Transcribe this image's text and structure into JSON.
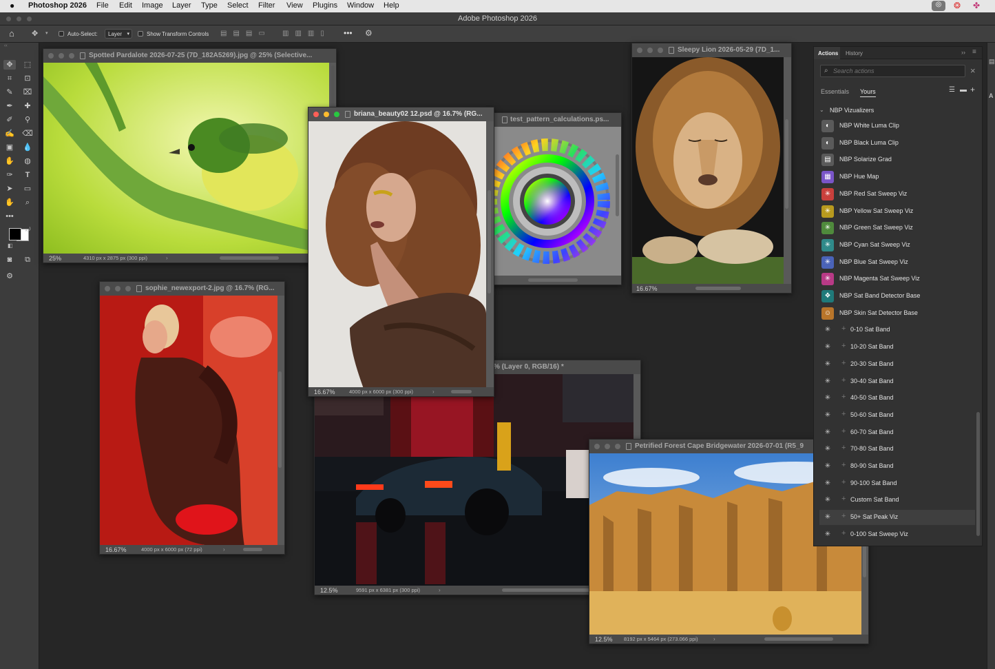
{
  "menubar": {
    "app_name": "Photoshop 2026",
    "items": [
      "File",
      "Edit",
      "Image",
      "Layer",
      "Type",
      "Select",
      "Filter",
      "View",
      "Plugins",
      "Window",
      "Help"
    ]
  },
  "window": {
    "title": "Adobe Photoshop 2026"
  },
  "options": {
    "auto_select_label": "Auto-Select:",
    "layer_dropdown": "Layer",
    "show_transform_label": "Show Transform Controls"
  },
  "documents": {
    "pardalote": {
      "title": "Spotted Pardalote 2026-07-25 (7D_182A5269).jpg @ 25% (Selective...",
      "zoom": "25%",
      "dims": "4310 px x 2875 px (300 ppi)"
    },
    "briana": {
      "title": "briana_beauty02 12.psd @ 16.7% (RG...",
      "zoom": "16.67%",
      "dims": "4000 px x 6000 px (300 ppi)"
    },
    "testpattern": {
      "title": "test_pattern_calculations.ps..."
    },
    "lion": {
      "title": "Sleepy Lion 2026-05-29 (7D_1...",
      "zoom": "16.67%"
    },
    "sophie": {
      "title": "sophie_newexport-2.jpg @ 16.7% (RG...",
      "zoom": "16.67%",
      "dims": "4000 px x 6000 px (72 ppi)"
    },
    "car": {
      "title": "% (Layer 0, RGB/16) *",
      "zoom": "12.5%",
      "dims": "9591 px x 6381 px (300 ppi)"
    },
    "forest": {
      "title": "Petrified Forest Cape Bridgewater 2026-07-01 (R5_9",
      "zoom": "12.5%",
      "dims": "8192 px x 5464 px (273.066 ppi)"
    }
  },
  "panel": {
    "tabs": [
      "Actions",
      "History"
    ],
    "search_placeholder": "Search actions",
    "subtabs": [
      "Essentials",
      "Yours"
    ],
    "group": "NBP Vizualizers",
    "actions": [
      {
        "label": "NBP White Luma Clip",
        "color": "#5a5a5a",
        "glyph": "◐"
      },
      {
        "label": "NBP Black Luma Clip",
        "color": "#5a5a5a",
        "glyph": "◐"
      },
      {
        "label": "NBP Solarize Grad",
        "color": "#5a5a5a",
        "glyph": "▤"
      },
      {
        "label": "NBP Hue Map",
        "color": "#7a55c8",
        "glyph": "▦"
      },
      {
        "label": "NBP Red Sat Sweep Viz",
        "color": "#c9403c",
        "glyph": "✳"
      },
      {
        "label": "NBP Yellow Sat Sweep Viz",
        "color": "#b89a1e",
        "glyph": "✳"
      },
      {
        "label": "NBP Green Sat Sweep Viz",
        "color": "#4f8a3c",
        "glyph": "✳"
      },
      {
        "label": "NBP Cyan Sat Sweep Viz",
        "color": "#2f8a8a",
        "glyph": "✳"
      },
      {
        "label": "NBP Blue Sat Sweep Viz",
        "color": "#4a63b8",
        "glyph": "✳"
      },
      {
        "label": "NBP Magenta Sat Sweep Viz",
        "color": "#b83a86",
        "glyph": "✳"
      },
      {
        "label": "NBP Sat Band Detector Base",
        "color": "#1f7a7a",
        "glyph": "❖"
      },
      {
        "label": "NBP Skin Sat Detector Base",
        "color": "#b8752a",
        "glyph": "☺"
      }
    ],
    "sub_actions": [
      "0-10 Sat Band",
      "10-20 Sat Band",
      "20-30 Sat Band",
      "30-40 Sat Band",
      "40-50 Sat Band",
      "50-60 Sat Band",
      "60-70 Sat Band",
      "70-80 Sat Band",
      "80-90 Sat Band",
      "90-100 Sat Band",
      "Custom Sat Band",
      "50+ Sat Peak Viz",
      "0-100 Sat Sweep Viz"
    ],
    "selected_sub": "50+ Sat Peak Viz"
  }
}
